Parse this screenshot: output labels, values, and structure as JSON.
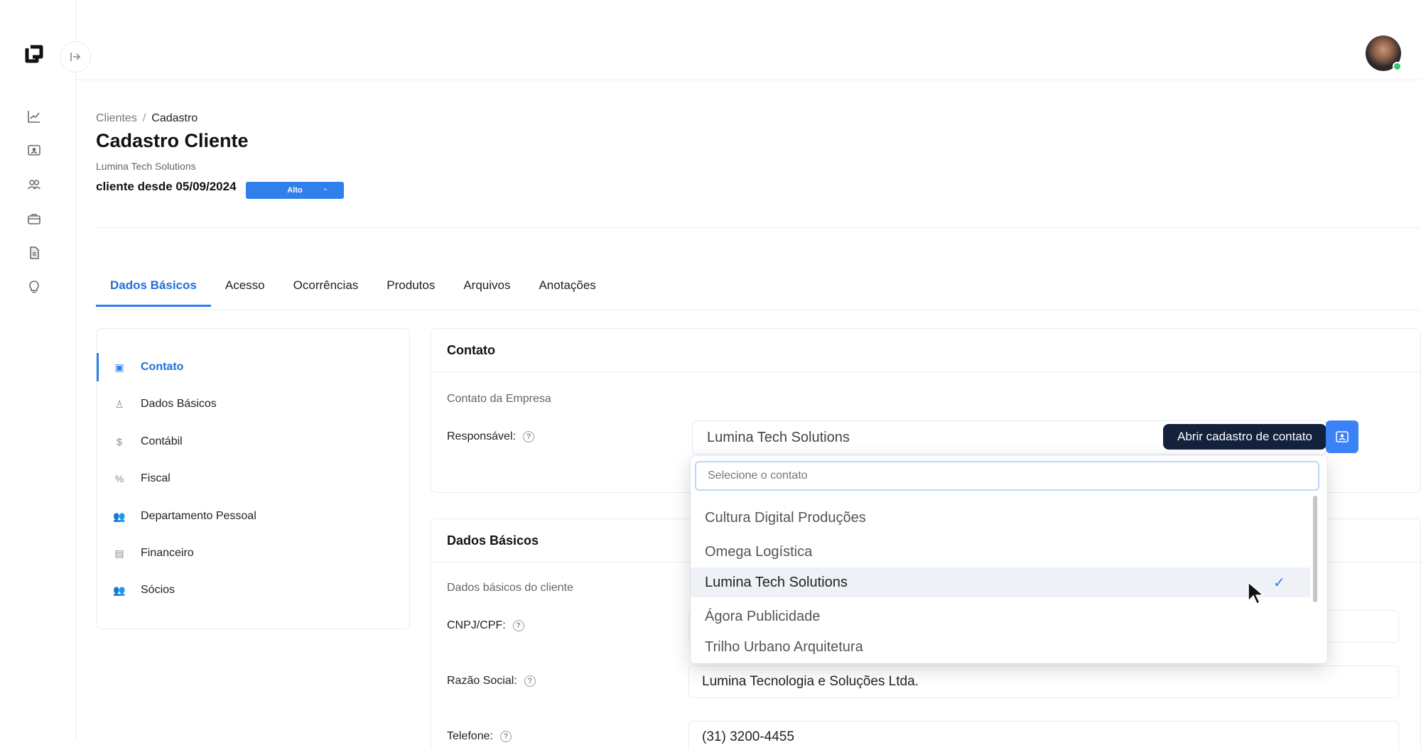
{
  "sidebar": {
    "icons": [
      "chart-line-icon",
      "contact-card-icon",
      "users-icon",
      "briefcase-icon",
      "document-icon",
      "lightbulb-icon"
    ]
  },
  "breadcrumb": {
    "root": "Clientes",
    "separator": "/",
    "current": "Cadastro"
  },
  "page": {
    "title": "Cadastro Cliente",
    "company": "Lumina Tech Solutions",
    "since": "cliente desde 05/09/2024",
    "priority_badge": "Alto",
    "badge_color": "#2f80ed"
  },
  "tabs": [
    "Dados Básicos",
    "Acesso",
    "Ocorrências",
    "Produtos",
    "Arquivos",
    "Anotações"
  ],
  "left_menu": {
    "items": [
      {
        "label": "Contato",
        "icon": "contact-card-icon",
        "symbol": "▣"
      },
      {
        "label": "Dados Básicos",
        "icon": "user-icon",
        "symbol": "♙"
      },
      {
        "label": "Contábil",
        "icon": "dollar-icon",
        "symbol": "$"
      },
      {
        "label": "Fiscal",
        "icon": "percent-icon",
        "symbol": "%"
      },
      {
        "label": "Departamento Pessoal",
        "icon": "users-icon",
        "symbol": "👥"
      },
      {
        "label": "Financeiro",
        "icon": "calculator-icon",
        "symbol": "▤"
      },
      {
        "label": "Sócios",
        "icon": "partners-icon",
        "symbol": "👥"
      }
    ]
  },
  "contato": {
    "title": "Contato",
    "subtitle": "Contato da Empresa",
    "responsavel_label": "Responsável:",
    "help": "?",
    "selected_value": "Lumina Tech Solutions",
    "tooltip": "Abrir cadastro de contato"
  },
  "dropdown": {
    "search_placeholder": "Selecione o contato",
    "options": [
      "Cultura Digital Produções",
      "Omega Logística",
      "Lumina Tech Solutions",
      "Ágora Publicidade",
      "Trilho Urbano Arquitetura"
    ],
    "selected": "Lumina Tech Solutions",
    "check": "✓"
  },
  "dados_basicos": {
    "title": "Dados Básicos",
    "subtitle": "Dados básicos do cliente",
    "cnpj_label": "CNPJ/CPF:",
    "razao_label": "Razão Social:",
    "razao_value": "Lumina Tecnologia e Soluções Ltda.",
    "telefone_label": "Telefone:",
    "telefone_value": "(31) 3200-4455"
  },
  "colors": {
    "accent": "#2f80ed",
    "tooltip_bg": "#14213d",
    "online": "#2ecc71"
  }
}
